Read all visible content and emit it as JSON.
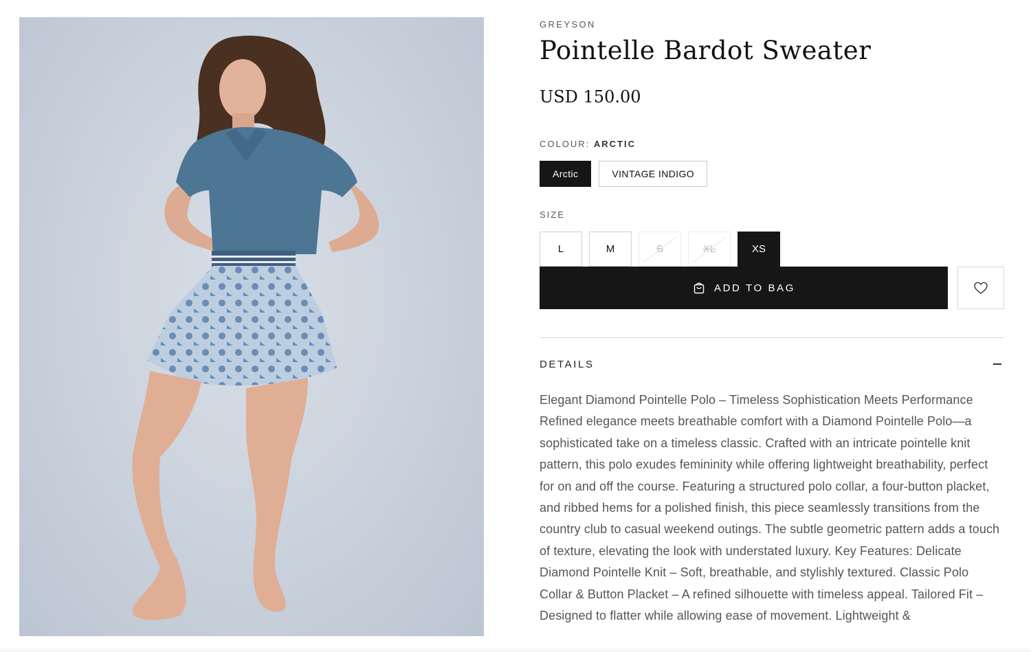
{
  "product": {
    "brand": "GREYSON",
    "title": "Pointelle Bardot Sweater",
    "price": "USD 150.00",
    "image_alt": "Model wearing a blue pointelle polo sweater with a blue toile print skirt"
  },
  "colour": {
    "label": "COLOUR:",
    "selected": "ARCTIC",
    "options": [
      "Arctic",
      "VINTAGE INDIGO"
    ]
  },
  "size": {
    "label": "SIZE",
    "options": [
      "L",
      "M",
      "S",
      "XL",
      "XS"
    ],
    "unavailable": [
      "S",
      "XL"
    ],
    "selected": "XS"
  },
  "actions": {
    "add_to_bag": "ADD TO BAG"
  },
  "details": {
    "title": "DETAILS",
    "description": "Elegant Diamond Pointelle Polo – Timeless Sophistication Meets Performance Refined elegance meets breathable comfort with a Diamond Pointelle Polo—a sophisticated take on a timeless classic. Crafted with an intricate pointelle knit pattern, this polo exudes femininity while offering lightweight breathability, perfect for on and off the course. Featuring a structured polo collar, a four-button placket, and ribbed hems for a polished finish, this piece seamlessly transitions from the country club to casual weekend outings. The subtle geometric pattern adds a touch of texture, elevating the look with understated luxury. Key Features: Delicate Diamond Pointelle Knit – Soft, breathable, and stylishly textured. Classic Polo Collar & Button Placket – A refined silhouette with timeless appeal. Tailored Fit – Designed to flatter while allowing ease of movement. Lightweight &"
  },
  "colors": {
    "primary": "#161616",
    "border": "#c9c9c9",
    "muted_text": "#555555",
    "photo_background": "#c9d1dc",
    "sweater": "#4d7594",
    "skirt": "#7f9fc4"
  },
  "icons": {
    "bag": "shopping-bag-icon",
    "wishlist": "heart-icon",
    "collapse": "minus-icon"
  }
}
